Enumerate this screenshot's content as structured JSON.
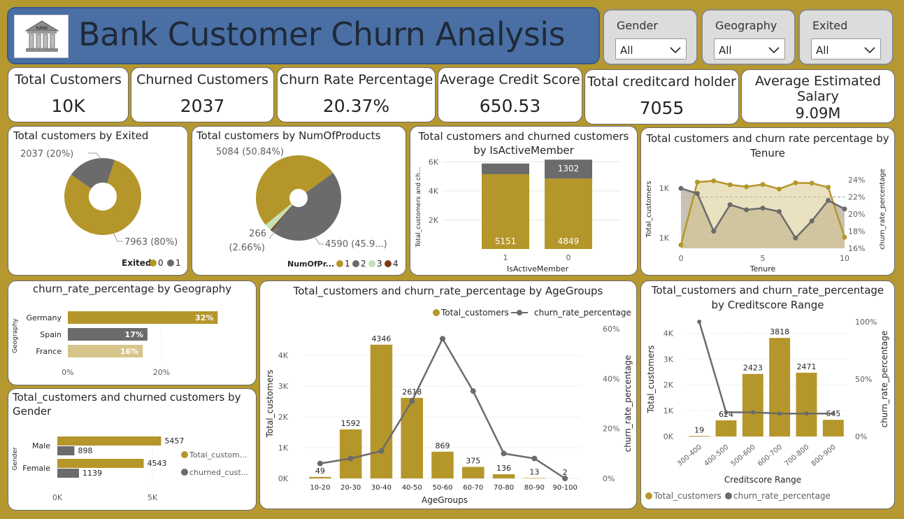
{
  "header": {
    "title": "Bank Customer Churn Analysis",
    "logo_text": "BANK"
  },
  "slicers": [
    {
      "label": "Gender",
      "value": "All"
    },
    {
      "label": "Geography",
      "value": "All"
    },
    {
      "label": "Exited",
      "value": "All"
    }
  ],
  "kpis": [
    {
      "label": "Total Customers",
      "value": "10K"
    },
    {
      "label": "Churned Customers",
      "value": "2037"
    },
    {
      "label": "Churn Rate Percentage",
      "value": "20.37%"
    },
    {
      "label": "Average Credit Score",
      "value": "650.53"
    },
    {
      "label": "Total creditcard holder",
      "value": "7055"
    },
    {
      "label": "Average Estimated Salary",
      "value": "9.09M"
    }
  ],
  "colors": {
    "gold": "#b5962a",
    "gray": "#6b6b6b",
    "light_green": "#c5e0b4",
    "brown": "#7a3b12",
    "light_gold": "#d6c48a"
  },
  "chart_data": [
    {
      "id": "exited",
      "type": "pie",
      "title": "Total customers by Exited",
      "legend_title": "Exited",
      "slices": [
        {
          "name": "0",
          "value": 7963,
          "label": "7963 (80%)"
        },
        {
          "name": "1",
          "value": 2037,
          "label": "2037 (20%)"
        }
      ]
    },
    {
      "id": "products",
      "type": "pie",
      "title": "Total customers by NumOfProducts",
      "legend_title": "NumOfPr...",
      "slices": [
        {
          "name": "1",
          "value": 5084,
          "label": "5084 (50.84%)"
        },
        {
          "name": "2",
          "value": 4590,
          "label": "4590 (45.9...)"
        },
        {
          "name": "3",
          "value": 266,
          "label": "266 (2.66%)"
        },
        {
          "name": "4",
          "value": 60,
          "label": ""
        }
      ]
    },
    {
      "id": "active",
      "type": "bar",
      "title_line1": "Total customers and churned customers",
      "title_line2": "by IsActiveMember",
      "xlabel": "IsActiveMember",
      "ylabel": "Total_customers and ch...",
      "categories": [
        "1",
        "0"
      ],
      "series": [
        {
          "name": "Total_customers",
          "values": [
            5151,
            4849
          ]
        },
        {
          "name": "churned_customers",
          "values": [
            735,
            1302
          ]
        }
      ],
      "yticks": [
        "2K",
        "4K",
        "6K"
      ],
      "data_labels_top": [
        "",
        "1302"
      ]
    },
    {
      "id": "tenure",
      "type": "area",
      "title_line1": "Total customers and churn rate percentage by",
      "title_line2": "Tenure",
      "xlabel": "Tenure",
      "ylabel": "Total_customers",
      "y2label": "churn_rate_percentage",
      "x": [
        0,
        1,
        2,
        3,
        4,
        5,
        6,
        7,
        8,
        9,
        10
      ],
      "total_customers": [
        413,
        1035,
        1048,
        1009,
        989,
        1012,
        967,
        1028,
        1025,
        984,
        490
      ],
      "churn_rate": [
        23.0,
        22.4,
        18.0,
        21.1,
        20.5,
        20.7,
        20.3,
        17.2,
        19.2,
        21.6,
        20.6
      ],
      "yticks_left": [
        "1K",
        "1K"
      ],
      "yticks_right": [
        "24%",
        "22%",
        "20%",
        "18%",
        "16%"
      ],
      "xticks": [
        "0",
        "5",
        "10"
      ]
    },
    {
      "id": "geography",
      "type": "bar",
      "title": "churn_rate_percentage by Geography",
      "ylabel": "Geography",
      "categories": [
        "Germany",
        "Spain",
        "France"
      ],
      "values": [
        32,
        17,
        16
      ],
      "labels": [
        "32%",
        "17%",
        "16%"
      ],
      "xticks": [
        "0%",
        "20%"
      ]
    },
    {
      "id": "gender",
      "type": "bar",
      "title_line1": "Total_customers and churned customers by",
      "title_line2": "Gender",
      "ylabel": "Gender",
      "categories": [
        "Male",
        "Female"
      ],
      "series": [
        {
          "name": "Total_custom...",
          "values": [
            5457,
            4543
          ]
        },
        {
          "name": "churned_cust...",
          "values": [
            898,
            1139
          ]
        }
      ],
      "xticks": [
        "0K",
        "5K"
      ]
    },
    {
      "id": "agegroups",
      "type": "bar",
      "title": "Total_customers and churn_rate_percentage by AgeGroups",
      "xlabel": "AgeGroups",
      "ylabel": "Total_customers",
      "y2label": "churn_rate_percentage",
      "legend": [
        "Total_customers",
        "churn_rate_percentage"
      ],
      "categories": [
        "10-20",
        "20-30",
        "30-40",
        "40-50",
        "50-60",
        "60-70",
        "70-80",
        "80-90",
        "90-100"
      ],
      "values": [
        49,
        1592,
        4346,
        2618,
        869,
        375,
        136,
        13,
        2
      ],
      "churn_rate": [
        6,
        8,
        11,
        31,
        56,
        35,
        10,
        8,
        0
      ],
      "yticks": [
        "0K",
        "1K",
        "2K",
        "3K",
        "4K"
      ],
      "y2ticks": [
        "0%",
        "20%",
        "40%",
        "60%"
      ]
    },
    {
      "id": "creditscore",
      "type": "bar",
      "title_line1": "Total_customers and churn_rate_percentage",
      "title_line2": "by Creditscore Range",
      "xlabel": "Creditscore Range",
      "ylabel": "Total_customers",
      "y2label": "churn_rate_percentage",
      "legend": [
        "Total_customers",
        "churn_rate_percentage"
      ],
      "categories": [
        "300-400",
        "400-500",
        "500-600",
        "600-700",
        "700-800",
        "800-900"
      ],
      "values": [
        19,
        624,
        2423,
        3818,
        2471,
        645
      ],
      "churn_rate": [
        100,
        21,
        21,
        20,
        20,
        20
      ],
      "yticks": [
        "0K",
        "1K",
        "2K",
        "3K",
        "4K"
      ],
      "y2ticks": [
        "0%",
        "50%",
        "100%"
      ]
    }
  ]
}
